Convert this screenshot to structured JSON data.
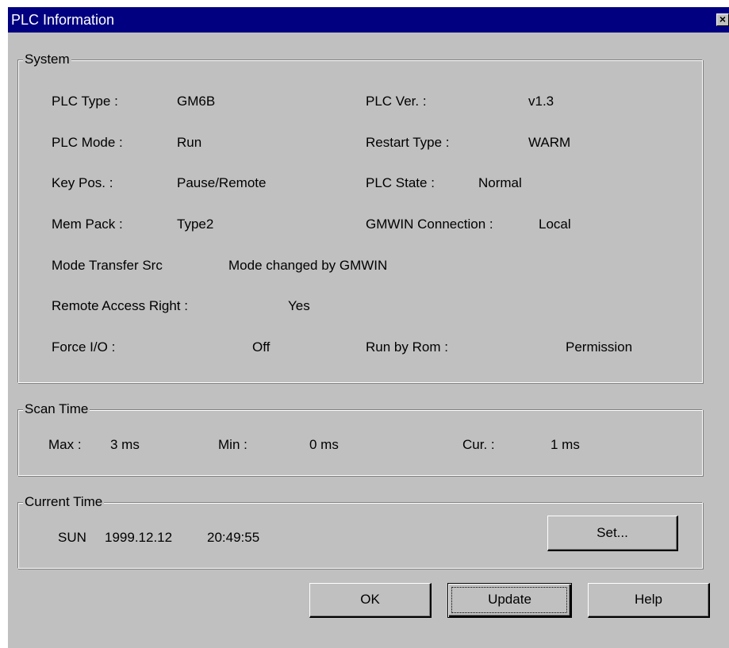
{
  "window": {
    "title": "PLC Information",
    "close_glyph": "×"
  },
  "system": {
    "legend": "System",
    "plc_type_label": "PLC Type :",
    "plc_type_value": "GM6B",
    "plc_ver_label": "PLC Ver. :",
    "plc_ver_value": "v1.3",
    "plc_mode_label": "PLC Mode :",
    "plc_mode_value": "Run",
    "restart_type_label": "Restart Type :",
    "restart_type_value": "WARM",
    "key_pos_label": "Key Pos. :",
    "key_pos_value": "Pause/Remote",
    "plc_state_label": "PLC State :",
    "plc_state_value": "Normal",
    "mem_pack_label": "Mem Pack :",
    "mem_pack_value": "Type2",
    "gmwin_connection_label": "GMWIN Connection :",
    "gmwin_connection_value": "Local",
    "mode_transfer_src_label": "Mode Transfer Src",
    "mode_transfer_src_value": "Mode changed by GMWIN",
    "remote_access_label": "Remote Access Right :",
    "remote_access_value": "Yes",
    "force_io_label": "Force I/O :",
    "force_io_value": "Off",
    "run_by_rom_label": "Run by Rom :",
    "run_by_rom_value": "Permission"
  },
  "scan_time": {
    "legend": "Scan Time",
    "max_label": "Max :",
    "max_value": "3 ms",
    "min_label": "Min :",
    "min_value": "0 ms",
    "cur_label": "Cur. :",
    "cur_value": "1 ms"
  },
  "current_time": {
    "legend": "Current Time",
    "day": "SUN",
    "date": "1999.12.12",
    "time": "20:49:55",
    "set_button": "Set..."
  },
  "buttons": {
    "ok": "OK",
    "update": "Update",
    "help": "Help"
  }
}
